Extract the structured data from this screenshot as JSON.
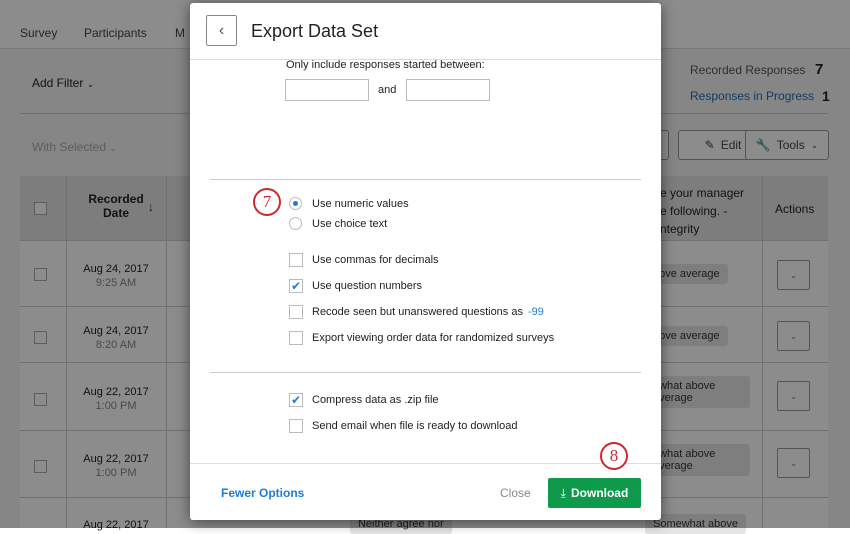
{
  "nav": {
    "tabs": [
      "Survey",
      "Participants",
      "M"
    ]
  },
  "toolbar": {
    "add_filter": "Add Filter",
    "with_selected": "With Selected",
    "edit": "Edit",
    "tools": "Tools"
  },
  "stats": {
    "recorded_label": "Recorded Responses",
    "recorded_count": "7",
    "progress_label": "Responses in Progress",
    "progress_count": "1"
  },
  "table": {
    "headers": {
      "date": "Recorded Date",
      "question": "e your manager\ne following. -\nntegrity",
      "actions": "Actions"
    },
    "rows": [
      {
        "date": "Aug 24, 2017",
        "time": "9:25 AM",
        "answer": "bove average"
      },
      {
        "date": "Aug 24, 2017",
        "time": "8:20 AM",
        "answer": "bove average"
      },
      {
        "date": "Aug 22, 2017",
        "time": "1:00 PM",
        "answer": "ewhat above average"
      },
      {
        "date": "Aug 22, 2017",
        "time": "1:00 PM",
        "answer": "ewhat above average"
      },
      {
        "date": "Aug 22, 2017",
        "time": "",
        "answer": "Somewhat above",
        "middle": "Neither agree nor"
      }
    ]
  },
  "modal": {
    "title": "Export Data Set",
    "date_range_label": "Only include responses started between:",
    "date_from": "",
    "date_to": "",
    "and": "and",
    "radios": [
      {
        "label": "Use numeric values",
        "selected": true
      },
      {
        "label": "Use choice text",
        "selected": false
      }
    ],
    "options": [
      {
        "label": "Use commas for decimals",
        "checked": false
      },
      {
        "label": "Use question numbers",
        "checked": true
      },
      {
        "label": "Recode seen but unanswered questions as",
        "checked": false,
        "value": "-99"
      },
      {
        "label": "Export viewing order data for randomized surveys",
        "checked": false
      }
    ],
    "file_options": [
      {
        "label": "Compress data as .zip file",
        "checked": true
      },
      {
        "label": "Send email when file is ready to download",
        "checked": false
      }
    ],
    "fewer_options": "Fewer Options",
    "close": "Close",
    "download": "Download"
  },
  "annotations": {
    "step7": "7",
    "step8": "8"
  },
  "colors": {
    "accent": "#1f7bd6",
    "download": "#0f9a4b",
    "badge": "#cc2a2f"
  }
}
